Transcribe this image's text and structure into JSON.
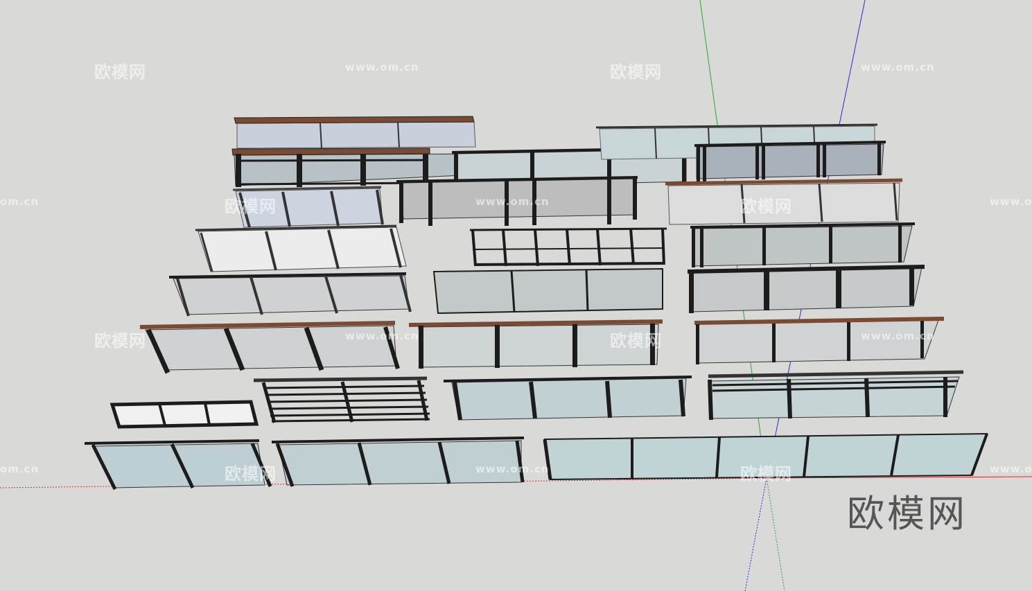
{
  "watermark": {
    "brand_cn": "欧模网",
    "url": "www.om.cn",
    "url_clipped": "om.cn",
    "url_partial": "www.om.cn"
  },
  "logo_text": "欧模网",
  "colors": {
    "background": "#d9d9d7",
    "glass": "#c3d2d4",
    "glass_light": "#d5dbe3",
    "frame": "#1c1c1c",
    "wood": "#7a4a32",
    "axis_red": "#d03030",
    "axis_green": "#2aa82a",
    "axis_blue": "#2a2ae0"
  }
}
